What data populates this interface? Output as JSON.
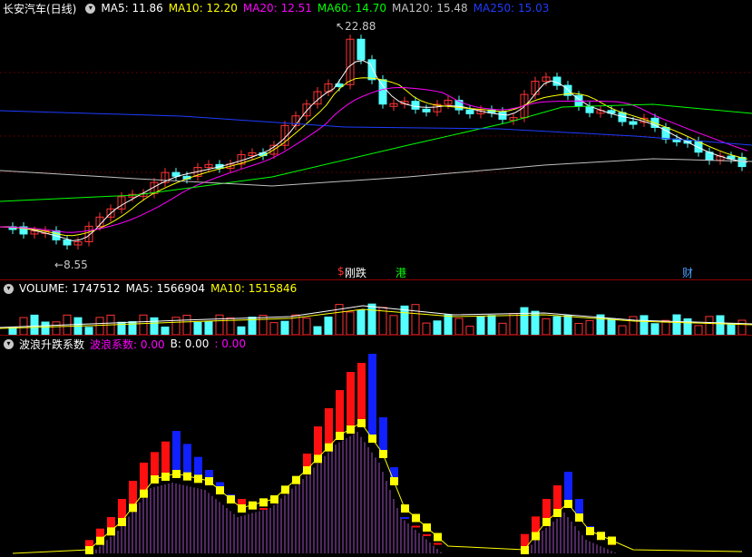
{
  "app": {
    "title": "长安汽车(日线)"
  },
  "price_panel": {
    "indicators": [
      {
        "label": "MA5: ",
        "value": "11.86",
        "color": "#ffffff"
      },
      {
        "label": "MA10: ",
        "value": "12.20",
        "color": "#ffff00"
      },
      {
        "label": "MA20: ",
        "value": "12.51",
        "color": "#ff00ff"
      },
      {
        "label": "MA60: ",
        "value": "14.70",
        "color": "#00ff00"
      },
      {
        "label": "MA120: ",
        "value": "15.48",
        "color": "#c0c0c0"
      },
      {
        "label": "MA250: ",
        "value": "15.03",
        "color": "#1e3cff"
      }
    ],
    "high_label": "22.88",
    "low_label": "8.55",
    "event_tags": [
      {
        "text": "$",
        "color": "#ff3030"
      },
      {
        "text": "刚跌",
        "color": "#ffffff"
      },
      {
        "text": "港",
        "color": "#00ff00"
      },
      {
        "text": "财",
        "color": "#4aa0ff"
      }
    ]
  },
  "volume_panel": {
    "title": "VOLUME: ",
    "value": "1747512",
    "ma5_label": "MA5: ",
    "ma5": "1566904",
    "ma10_label": "MA10: ",
    "ma10": "1515846"
  },
  "wave_panel": {
    "title": "波浪升跌系数",
    "coef_label": "波浪系数: ",
    "coef": "0.00",
    "b_label": "B: ",
    "b": "0.00",
    "extra": ": 0.00"
  },
  "colors": {
    "up": "#ff3333",
    "down": "#54ffff",
    "bg": "#000000"
  }
}
